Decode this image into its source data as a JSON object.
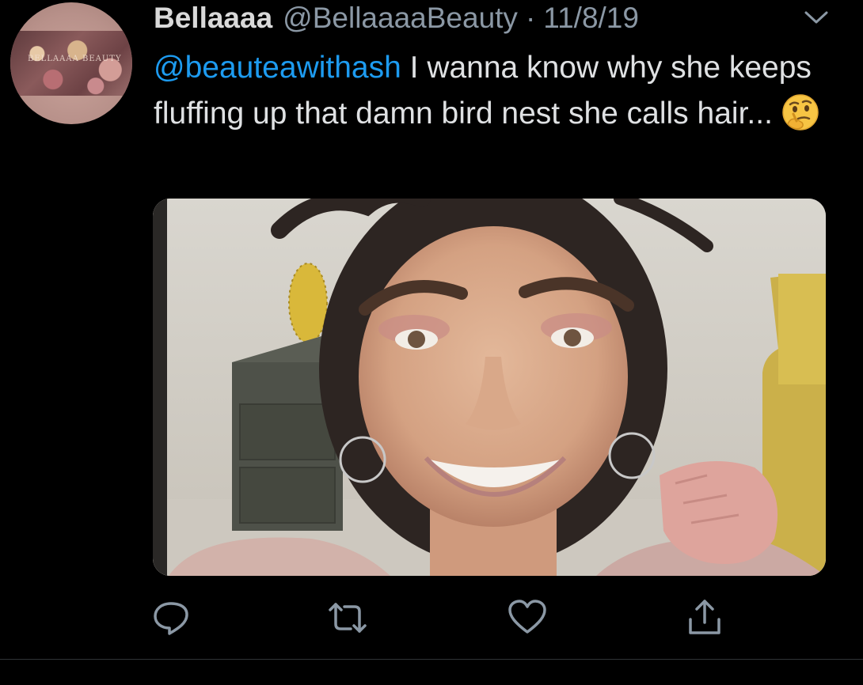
{
  "author": {
    "display_name": "Bellaaaa",
    "handle": "@BellaaaaBeauty",
    "separator": "·",
    "date": "11/8/19",
    "avatar_text": "BELLAAAA BEAUTY"
  },
  "tweet": {
    "mention": "@beauteawithash",
    "text": " I wanna know why she keeps fluffing up that damn bird nest she calls hair...",
    "emoji": "thinking-face"
  },
  "media": {
    "type": "video-thumbnail"
  },
  "actions": [
    {
      "name": "reply",
      "icon": "reply-icon"
    },
    {
      "name": "retweet",
      "icon": "retweet-icon"
    },
    {
      "name": "like",
      "icon": "heart-icon"
    },
    {
      "name": "share",
      "icon": "share-icon"
    }
  ],
  "colors": {
    "background": "#000000",
    "link": "#1d9bf0",
    "secondary": "#8b98a5",
    "icon": "#8b98a5"
  }
}
